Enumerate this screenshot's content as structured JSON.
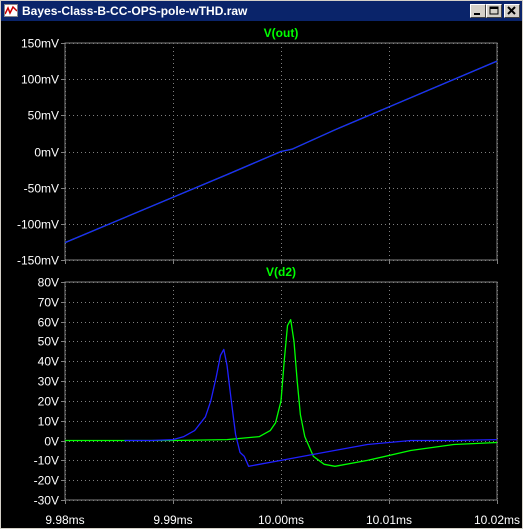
{
  "window": {
    "title": "Bayes-Class-B-CC-OPS-pole-wTHD.raw",
    "minimize_icon": "minimize-icon",
    "maximize_icon": "maximize-icon",
    "close_icon": "close-icon"
  },
  "colors": {
    "background": "#000000",
    "grid": "#808080",
    "axis_text": "#ffffff",
    "green_trace": "#00ff00",
    "blue_trace": "#2020ff",
    "title_text": "#00ff00"
  },
  "x_axis": {
    "ticks": [
      "9.98ms",
      "9.99ms",
      "10.00ms",
      "10.01ms",
      "10.02ms"
    ],
    "range": [
      9.98,
      10.02
    ],
    "unit": "ms"
  },
  "chart_data": [
    {
      "type": "line",
      "title": "V(out)",
      "xlabel": "",
      "ylabel": "",
      "xlim": [
        9.98,
        10.02
      ],
      "ylim": [
        -150,
        150
      ],
      "x_ticks": [
        "9.98ms",
        "9.99ms",
        "10.00ms",
        "10.01ms",
        "10.02ms"
      ],
      "y_ticks": [
        "150mV",
        "100mV",
        "50mV",
        "0mV",
        "-50mV",
        "-100mV",
        "-150mV"
      ],
      "y_tick_values": [
        150,
        100,
        50,
        0,
        -50,
        -100,
        -150
      ],
      "grid": true,
      "series": [
        {
          "color": "#00ff00",
          "x": [
            9.98,
            9.995,
            10.0,
            10.001,
            10.005,
            10.02
          ],
          "y": [
            -126,
            -32,
            0,
            3,
            30,
            125
          ]
        },
        {
          "color": "#2020ff",
          "x": [
            9.98,
            9.995,
            10.0,
            10.001,
            10.005,
            10.02
          ],
          "y": [
            -126,
            -32,
            0,
            3,
            30,
            125
          ]
        }
      ]
    },
    {
      "type": "line",
      "title": "V(d2)",
      "xlabel": "",
      "ylabel": "",
      "xlim": [
        9.98,
        10.02
      ],
      "ylim": [
        -30,
        80
      ],
      "x_ticks": [
        "9.98ms",
        "9.99ms",
        "10.00ms",
        "10.01ms",
        "10.02ms"
      ],
      "y_ticks": [
        "80V",
        "70V",
        "60V",
        "50V",
        "40V",
        "30V",
        "20V",
        "10V",
        "0V",
        "-10V",
        "-20V",
        "-30V"
      ],
      "y_tick_values": [
        80,
        70,
        60,
        50,
        40,
        30,
        20,
        10,
        0,
        -10,
        -20,
        -30
      ],
      "grid": true,
      "series": [
        {
          "color": "#00ff00",
          "x": [
            9.98,
            9.99,
            9.995,
            9.998,
            9.999,
            9.9995,
            10.0,
            10.0003,
            10.0006,
            10.0009,
            10.0012,
            10.0015,
            10.0018,
            10.0022,
            10.003,
            10.004,
            10.005,
            10.008,
            10.012,
            10.016,
            10.02
          ],
          "y": [
            0,
            0,
            0.5,
            2,
            5,
            9,
            20,
            40,
            58,
            61,
            50,
            30,
            13,
            2,
            -8,
            -12,
            -13,
            -10,
            -5,
            -2,
            -1
          ]
        },
        {
          "color": "#2020ff",
          "x": [
            9.9855,
            9.988,
            9.99,
            9.991,
            9.992,
            9.993,
            9.9935,
            9.994,
            9.9944,
            9.9947,
            9.995,
            9.9954,
            9.9958,
            9.9962,
            9.9966,
            9.997,
            9.998,
            10.0,
            10.004,
            10.008,
            10.012,
            10.016,
            10.02
          ],
          "y": [
            0,
            0,
            0.5,
            2,
            5,
            12,
            20,
            32,
            43,
            46,
            38,
            20,
            3,
            -6,
            -8,
            -13,
            -12,
            -10,
            -6,
            -2,
            0,
            0,
            0.5
          ]
        }
      ]
    }
  ]
}
